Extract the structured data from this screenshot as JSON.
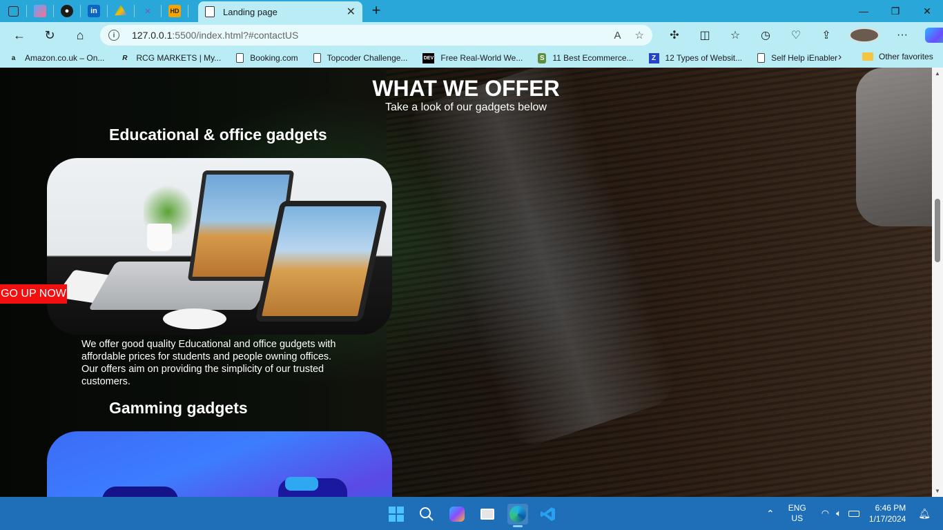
{
  "browser": {
    "active_tab_title": "Landing page",
    "url_host": "127.0.0.1",
    "url_path": ":5500/index.html?#contactUS",
    "favorites": [
      {
        "label": "Amazon.co.uk – On...",
        "icon": "amazon-icon"
      },
      {
        "label": "RCG MARKETS | My...",
        "icon": "rcg-icon"
      },
      {
        "label": "Booking.com",
        "icon": "page-icon"
      },
      {
        "label": "Topcoder Challenge...",
        "icon": "page-icon"
      },
      {
        "label": "Free Real-World We...",
        "icon": "dev-icon"
      },
      {
        "label": "11 Best Ecommerce...",
        "icon": "shopify-icon"
      },
      {
        "label": "12 Types of Websit...",
        "icon": "site-icon"
      },
      {
        "label": "Self Help iEnabler",
        "icon": "page-icon"
      }
    ],
    "other_favorites": "Other favorites"
  },
  "page": {
    "section_title": "WHAT WE OFFER",
    "section_subtitle": "Take a look of our gadgets below",
    "categories": [
      {
        "title": "Educational & office gadgets",
        "description": "We offer good quality Educational and office gudgets with affordable prices for students and people owning offices. Our offers aim on providing the simplicity of our trusted customers."
      },
      {
        "title": "Gamming gadgets"
      }
    ],
    "go_up_label": "GO UP NOW"
  },
  "taskbar": {
    "lang_line1": "ENG",
    "lang_line2": "US",
    "time": "6:46 PM",
    "date": "1/17/2024",
    "pinned": [
      "windows-start-icon",
      "search-icon",
      "copilot-pre-icon",
      "task-view-icon",
      "edge-icon",
      "vscode-icon"
    ]
  },
  "colors": {
    "tabbar": "#2aa7d9",
    "toolbar": "#b9ecf5",
    "go_up_bg": "#f10f0f",
    "taskbar": "#1f6fb8"
  }
}
